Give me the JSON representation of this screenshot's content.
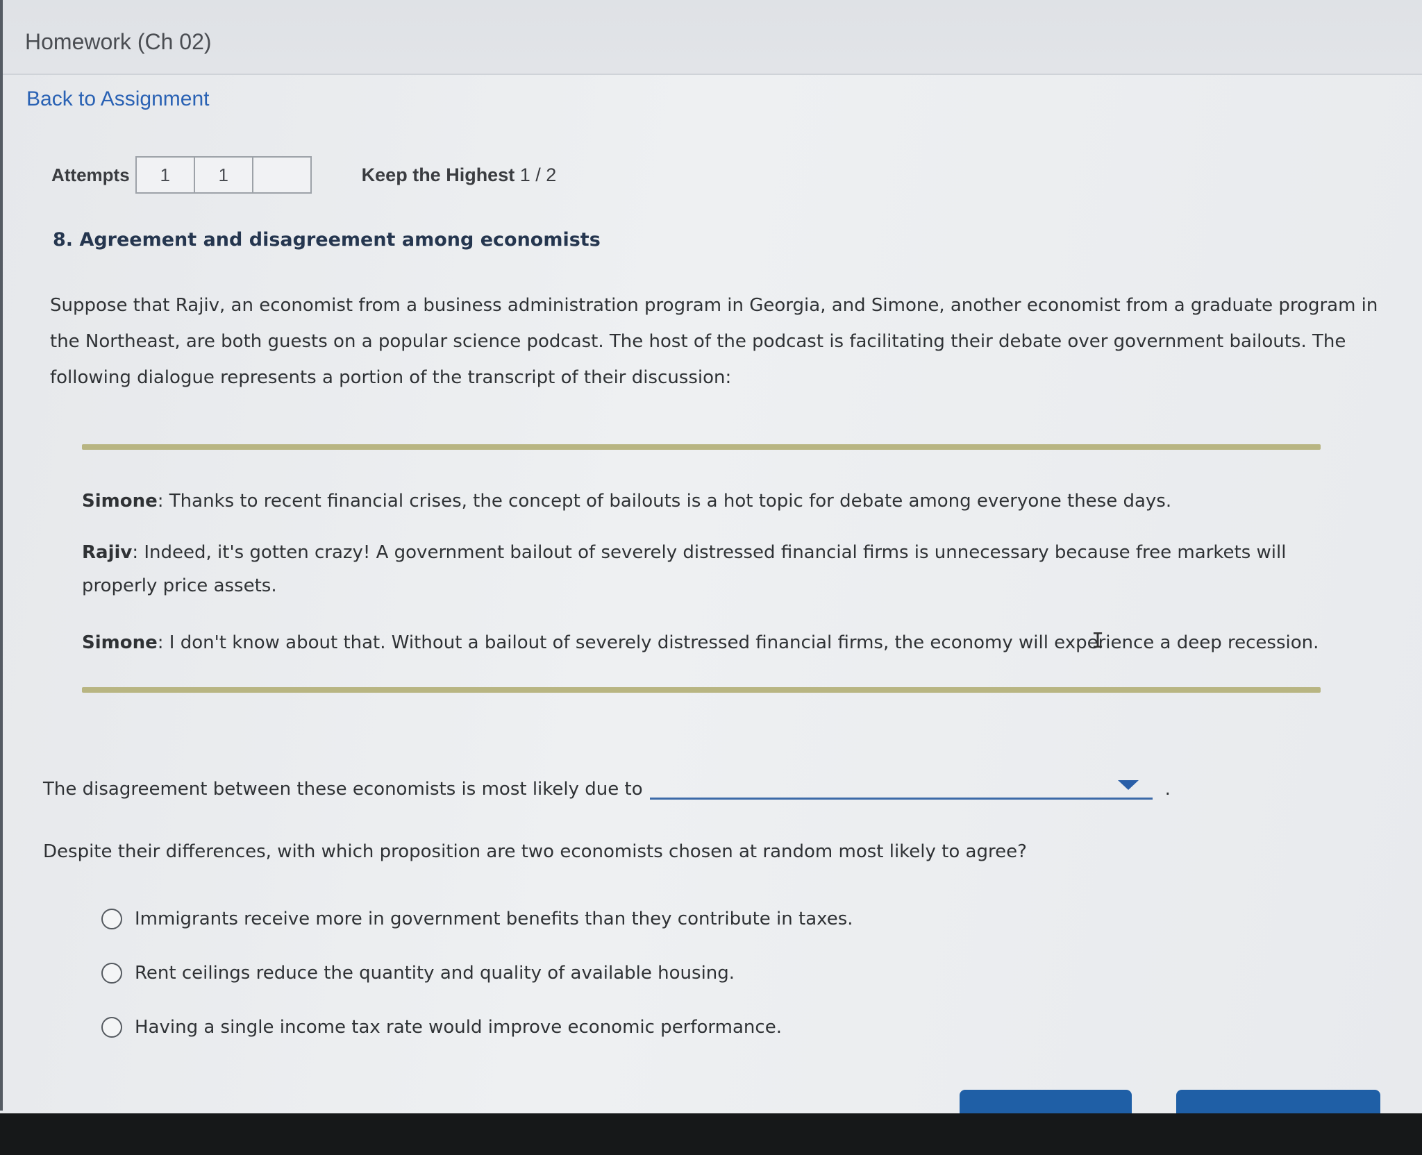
{
  "header": {
    "title": "Homework (Ch 02)",
    "back_link": "Back to Assignment"
  },
  "attempts": {
    "label": "Attempts",
    "boxes": [
      "1",
      "1",
      ""
    ],
    "keep_highest_label": "Keep the Highest",
    "keep_highest_value": "1 / 2"
  },
  "question": {
    "title": "8. Agreement and disagreement among economists",
    "intro": "Suppose that Rajiv, an economist from a business administration program in Georgia, and Simone, another economist from a graduate program in the Northeast, are both guests on a popular science podcast. The host of the podcast is facilitating their debate over government bailouts. The following dialogue represents a portion of the transcript of their discussion:",
    "dialogue": [
      {
        "speaker": "Simone",
        "text": ": Thanks to recent financial crises, the concept of bailouts is a hot topic for debate among everyone these days."
      },
      {
        "speaker": "Rajiv",
        "text": ": Indeed, it's gotten crazy! A government bailout of severely distressed financial firms is unnecessary because free markets will properly price assets."
      },
      {
        "speaker": "Simone",
        "text": ": I don't know about that. Without a bailout of severely distressed financial firms, the economy will experience a deep recession."
      }
    ],
    "dropdown_prompt": "The disagreement between these economists is most likely due to",
    "dropdown_value": "",
    "dropdown_suffix": ".",
    "mc_prompt": "Despite their differences, with which proposition are two economists chosen at random most likely to agree?",
    "options": [
      "Immigrants receive more in government benefits than they contribute in taxes.",
      "Rent ceilings reduce the quantity and quality of available housing.",
      "Having a single income tax rate would improve economic performance."
    ]
  },
  "colors": {
    "link": "#2a62b4",
    "rule": "#b8b582",
    "button": "#1f5fa6"
  },
  "icons": {
    "dropdown": "caret-down-icon",
    "radio": "radio-unselected-icon"
  }
}
